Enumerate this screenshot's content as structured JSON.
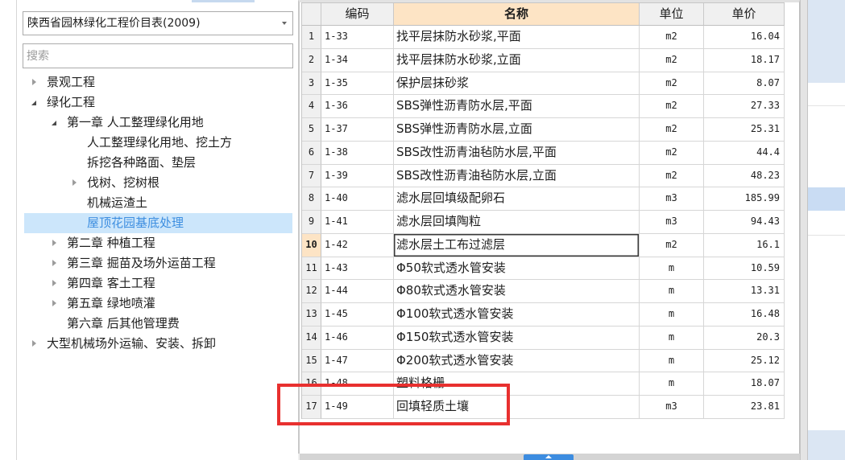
{
  "left_panel": {
    "price_list_select": {
      "value": "陕西省园林绿化工程价目表(2009)",
      "icon": "chevron-down-icon"
    },
    "search": {
      "placeholder": "搜索"
    },
    "tree": [
      {
        "label": "景观工程",
        "level": 0,
        "toggle_icon": "triangle-right-icon"
      },
      {
        "label": "绿化工程",
        "level": 0,
        "toggle_icon": "triangle-down-icon"
      },
      {
        "label": "第一章 人工整理绿化用地",
        "level": 1,
        "toggle_icon": "triangle-down-icon"
      },
      {
        "label": "人工整理绿化用地、挖土方",
        "level": 2,
        "toggle_icon": ""
      },
      {
        "label": "拆挖各种路面、垫层",
        "level": 2,
        "toggle_icon": ""
      },
      {
        "label": "伐树、挖树根",
        "level": 2,
        "toggle_icon": "triangle-right-icon"
      },
      {
        "label": "机械运渣土",
        "level": 2,
        "toggle_icon": ""
      },
      {
        "label": "屋顶花园基底处理",
        "level": 2,
        "toggle_icon": "",
        "selected": true
      },
      {
        "label": "第二章 种植工程",
        "level": 1,
        "toggle_icon": "triangle-right-icon"
      },
      {
        "label": "第三章 掘苗及场外运苗工程",
        "level": 1,
        "toggle_icon": "triangle-right-icon"
      },
      {
        "label": "第四章 客土工程",
        "level": 1,
        "toggle_icon": "triangle-right-icon"
      },
      {
        "label": "第五章 绿地喷灌",
        "level": 1,
        "toggle_icon": "triangle-right-icon"
      },
      {
        "label": "第六章 后其他管理费",
        "level": 1,
        "toggle_icon": ""
      },
      {
        "label": "大型机械场外运输、安装、拆卸",
        "level": 0,
        "toggle_icon": "triangle-right-icon"
      }
    ]
  },
  "table": {
    "columns": [
      {
        "label": "",
        "active": false
      },
      {
        "label": "编码",
        "active": false
      },
      {
        "label": "名称",
        "active": true
      },
      {
        "label": "单位",
        "active": false
      },
      {
        "label": "单价",
        "active": false
      }
    ],
    "rows": [
      {
        "no": "1",
        "code": "1-33",
        "name": "找平层抹防水砂浆,平面",
        "unit": "m2",
        "price": "16.04"
      },
      {
        "no": "2",
        "code": "1-34",
        "name": "找平层抹防水砂浆,立面",
        "unit": "m2",
        "price": "18.17"
      },
      {
        "no": "3",
        "code": "1-35",
        "name": "保护层抹砂浆",
        "unit": "m2",
        "price": "8.07"
      },
      {
        "no": "4",
        "code": "1-36",
        "name": "SBS弹性沥青防水层,平面",
        "unit": "m2",
        "price": "27.33"
      },
      {
        "no": "5",
        "code": "1-37",
        "name": "SBS弹性沥青防水层,立面",
        "unit": "m2",
        "price": "25.31"
      },
      {
        "no": "6",
        "code": "1-38",
        "name": "SBS改性沥青油毡防水层,平面",
        "unit": "m2",
        "price": "44.4"
      },
      {
        "no": "7",
        "code": "1-39",
        "name": "SBS改性沥青油毡防水层,立面",
        "unit": "m2",
        "price": "48.23"
      },
      {
        "no": "8",
        "code": "1-40",
        "name": "滤水层回填级配卵石",
        "unit": "m3",
        "price": "185.99"
      },
      {
        "no": "9",
        "code": "1-41",
        "name": "滤水层回填陶粒",
        "unit": "m3",
        "price": "94.43"
      },
      {
        "no": "10",
        "code": "1-42",
        "name": "滤水层土工布过滤层",
        "unit": "m2",
        "price": "16.1",
        "selected": true
      },
      {
        "no": "11",
        "code": "1-43",
        "name": "Φ50软式透水管安装",
        "unit": "m",
        "price": "10.59"
      },
      {
        "no": "12",
        "code": "1-44",
        "name": "Φ80软式透水管安装",
        "unit": "m",
        "price": "13.31"
      },
      {
        "no": "13",
        "code": "1-45",
        "name": "Φ100软式透水管安装",
        "unit": "m",
        "price": "16.48"
      },
      {
        "no": "14",
        "code": "1-46",
        "name": "Φ150软式透水管安装",
        "unit": "m",
        "price": "20.3"
      },
      {
        "no": "15",
        "code": "1-47",
        "name": "Φ200软式透水管安装",
        "unit": "m",
        "price": "25.12"
      },
      {
        "no": "16",
        "code": "1-48",
        "name": "塑料格栅",
        "unit": "m",
        "price": "18.07"
      },
      {
        "no": "17",
        "code": "1-49",
        "name": "回填轻质土壤",
        "unit": "m3",
        "price": "23.81"
      }
    ]
  },
  "colors": {
    "tree_selection_bg": "#cce6fb",
    "tree_selection_text": "#3d8ee0",
    "active_header_bg": "#fde4c5",
    "focus_border": "#3a3a3a",
    "annotation_red": "#e8302f",
    "splitter_blue": "#3c8ce0",
    "side_panel_blue": "#dbe6f3",
    "side_panel_selected": "#c9dcf3"
  }
}
